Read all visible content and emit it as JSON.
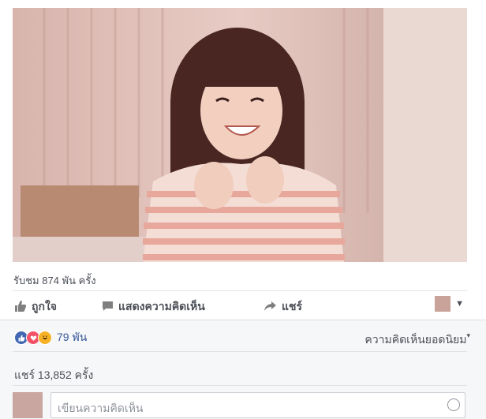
{
  "video": {
    "views_text": "รับชม 874 พัน ครั้ง"
  },
  "actions": {
    "like_label": "ถูกใจ",
    "comment_label": "แสดงความคิดเห็น",
    "share_label": "แชร์"
  },
  "reactions": {
    "count": "79 พัน",
    "sort_label": "ความคิดเห็นยอดนิยม"
  },
  "shares_text": "แชร์ 13,852 ครั้ง",
  "comment": {
    "placeholder": "เขียนความคิดเห็น"
  },
  "colors": {
    "link": "#365899",
    "like_blue": "#4267b2",
    "love_red": "#f25268",
    "haha_yellow": "#f7b125"
  }
}
